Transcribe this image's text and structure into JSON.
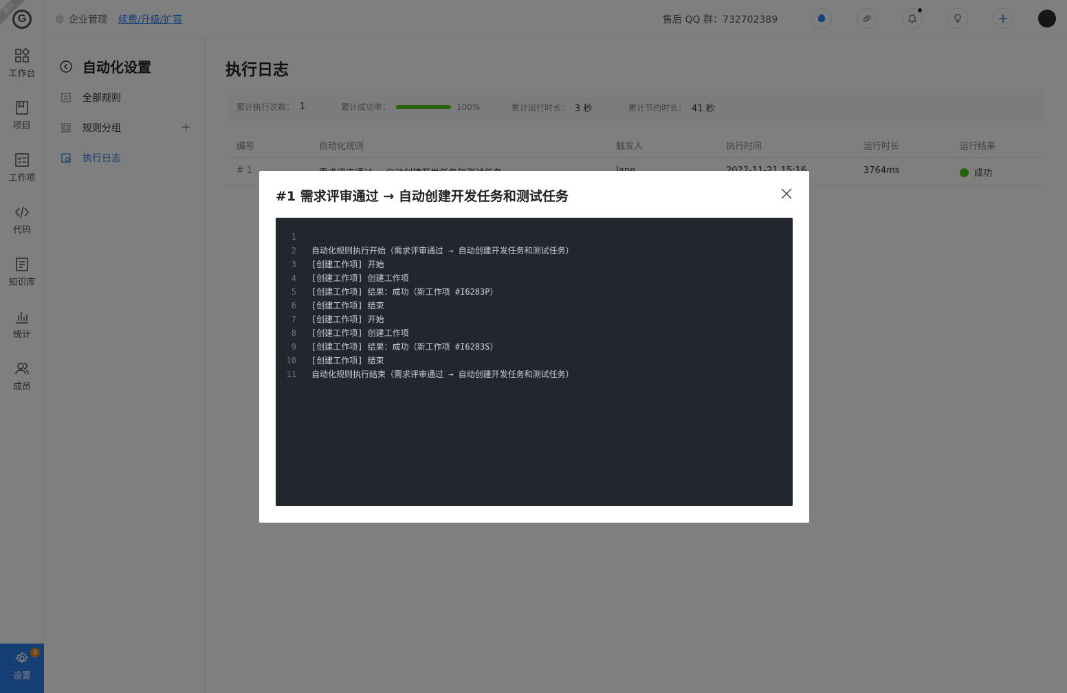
{
  "app": {
    "logo_letter": "G",
    "logo_ribbon": "高级"
  },
  "rail": {
    "items": [
      {
        "label": "工作台",
        "icon": "dashboard-icon"
      },
      {
        "label": "项目",
        "icon": "project-icon"
      },
      {
        "label": "工作项",
        "icon": "workitem-icon"
      },
      {
        "label": "代码",
        "icon": "code-icon"
      },
      {
        "label": "知识库",
        "icon": "knowledge-icon"
      },
      {
        "label": "统计",
        "icon": "chart-icon"
      },
      {
        "label": "成员",
        "icon": "members-icon"
      }
    ],
    "settings": {
      "label": "设置",
      "badge": "9"
    }
  },
  "topbar": {
    "breadcrumb": "企业管理",
    "renew_link": "续费/升级/扩容",
    "qq_text": "售后 QQ 群：732702389",
    "icons": [
      "assistant-icon",
      "link-icon",
      "bell-icon",
      "lightbulb-icon",
      "plus-icon"
    ]
  },
  "subnav": {
    "title": "自动化设置",
    "items": [
      {
        "label": "全部规则"
      },
      {
        "label": "规则分组"
      },
      {
        "label": "执行日志"
      }
    ]
  },
  "main": {
    "title": "执行日志",
    "stats": {
      "runs_label": "累计执行次数：",
      "runs_value": "1",
      "success_label": "累计成功率：",
      "success_value": "100%",
      "success_fraction": 1.0,
      "runtime_label": "累计运行时长：",
      "runtime_value": "3 秒",
      "saved_label": "累计节约时长：",
      "saved_value": "41 秒"
    },
    "table": {
      "headers": [
        "编号",
        "自动化规则",
        "触发人",
        "执行时间",
        "运行时长",
        "运行结果"
      ],
      "rows": [
        {
          "id": "# 1",
          "rule": "需求评审通过 → 自动创建开发任务和测试任务",
          "trigger": "Jane",
          "time": "2022-11-21 15:16",
          "duration": "3764ms",
          "result": "成功"
        }
      ]
    }
  },
  "modal": {
    "title": "#1 需求评审通过 → 自动创建开发任务和测试任务",
    "log_lines": [
      {
        "n": "1",
        "t": ""
      },
      {
        "n": "2",
        "t": "自动化规则执行开始（需求评审通过 → 自动创建开发任务和测试任务）"
      },
      {
        "n": "3",
        "t": "[创建工作项] 开始"
      },
      {
        "n": "4",
        "t": "[创建工作项] 创建工作项"
      },
      {
        "n": "5",
        "t": "[创建工作项] 结果：成功（新工作项 #I6283P）"
      },
      {
        "n": "6",
        "t": "[创建工作项] 结束"
      },
      {
        "n": "7",
        "t": "[创建工作项] 开始"
      },
      {
        "n": "8",
        "t": "[创建工作项] 创建工作项"
      },
      {
        "n": "9",
        "t": "[创建工作项] 结果：成功（新工作项 #I6283S）"
      },
      {
        "n": "10",
        "t": "[创建工作项] 结束"
      },
      {
        "n": "11",
        "t": "自动化规则执行结束（需求评审通过 → 自动创建开发任务和测试任务）"
      }
    ]
  },
  "colors": {
    "accent": "#2b7de9",
    "success": "#52c41a",
    "code_bg": "#22272e"
  }
}
